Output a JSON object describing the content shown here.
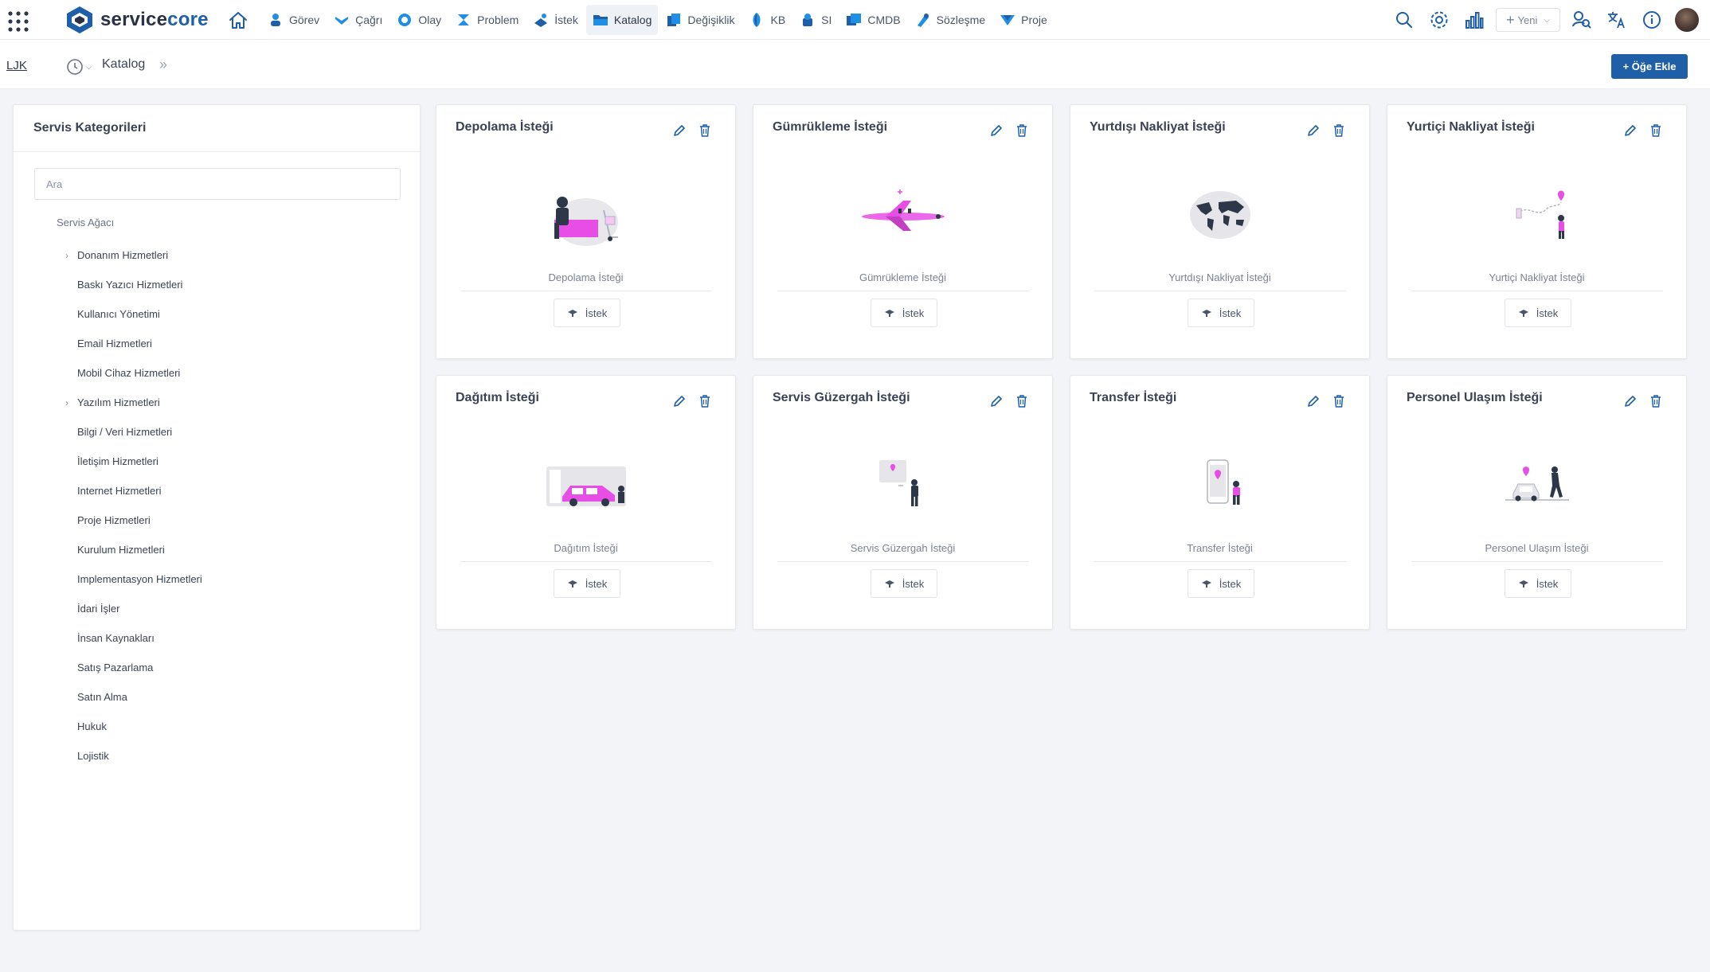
{
  "brand": {
    "name_part1": "service",
    "name_part2": "core",
    "accent_color": "#1f5fa8",
    "highlight_color": "#e64ee6"
  },
  "nav": {
    "items": [
      {
        "label": "Görev",
        "icon": "task-icon",
        "active": false
      },
      {
        "label": "Çağrı",
        "icon": "call-icon",
        "active": false
      },
      {
        "label": "Olay",
        "icon": "incident-icon",
        "active": false
      },
      {
        "label": "Problem",
        "icon": "problem-icon",
        "active": false
      },
      {
        "label": "İstek",
        "icon": "request-icon",
        "active": false
      },
      {
        "label": "Katalog",
        "icon": "catalog-icon",
        "active": true
      },
      {
        "label": "Değişiklik",
        "icon": "change-icon",
        "active": false
      },
      {
        "label": "KB",
        "icon": "kb-icon",
        "active": false
      },
      {
        "label": "SI",
        "icon": "si-icon",
        "active": false
      },
      {
        "label": "CMDB",
        "icon": "cmdb-icon",
        "active": false
      },
      {
        "label": "Sözleşme",
        "icon": "contract-icon",
        "active": false
      },
      {
        "label": "Proje",
        "icon": "project-icon",
        "active": false
      }
    ],
    "new_label": "Yeni"
  },
  "subheader": {
    "workspace": "LJK",
    "page_title": "Katalog",
    "add_item_label": "+ Öğe Ekle"
  },
  "sidebar": {
    "title": "Servis Kategorileri",
    "search_placeholder": "Ara",
    "tree_root": "Servis Ağacı",
    "items": [
      {
        "label": "Donanım Hizmetleri",
        "expandable": true
      },
      {
        "label": "Baskı Yazıcı Hizmetleri",
        "expandable": false
      },
      {
        "label": "Kullanıcı Yönetimi",
        "expandable": false
      },
      {
        "label": "Email Hizmetleri",
        "expandable": false
      },
      {
        "label": "Mobil Cihaz Hizmetleri",
        "expandable": false
      },
      {
        "label": "Yazılım Hizmetleri",
        "expandable": true
      },
      {
        "label": "Bilgi / Veri Hizmetleri",
        "expandable": false
      },
      {
        "label": "İletişim Hizmetleri",
        "expandable": false
      },
      {
        "label": "Internet Hizmetleri",
        "expandable": false
      },
      {
        "label": "Proje Hizmetleri",
        "expandable": false
      },
      {
        "label": "Kurulum Hizmetleri",
        "expandable": false
      },
      {
        "label": "Implementasyon Hizmetleri",
        "expandable": false
      },
      {
        "label": "İdari İşler",
        "expandable": false
      },
      {
        "label": "İnsan Kaynakları",
        "expandable": false
      },
      {
        "label": "Satış Pazarlama",
        "expandable": false
      },
      {
        "label": "Satın Alma",
        "expandable": false
      },
      {
        "label": "Hukuk",
        "expandable": false
      },
      {
        "label": "Lojistik",
        "expandable": false
      }
    ]
  },
  "cards": [
    {
      "title": "Depolama İsteği",
      "subtitle": "Depolama İsteği",
      "button": "İstek",
      "illustration": "storage-illustration"
    },
    {
      "title": "Gümrükleme İsteği",
      "subtitle": "Gümrükleme İsteği",
      "button": "İstek",
      "illustration": "airplane-illustration"
    },
    {
      "title": "Yurtdışı Nakliyat İsteği",
      "subtitle": "Yurtdışı Nakliyat İsteği",
      "button": "İstek",
      "illustration": "world-map-illustration"
    },
    {
      "title": "Yurtiçi Nakliyat İsteği",
      "subtitle": "Yurtiçi Nakliyat İsteği",
      "button": "İstek",
      "illustration": "route-illustration"
    },
    {
      "title": "Dağıtım İsteği",
      "subtitle": "Dağıtım İsteği",
      "button": "İstek",
      "illustration": "delivery-truck-illustration"
    },
    {
      "title": "Servis Güzergah İsteği",
      "subtitle": "Servis Güzergah İsteği",
      "button": "İstek",
      "illustration": "map-pin-person-illustration"
    },
    {
      "title": "Transfer İsteği",
      "subtitle": "Transfer İsteği",
      "button": "İstek",
      "illustration": "phone-location-illustration"
    },
    {
      "title": "Personel Ulaşım İsteği",
      "subtitle": "Personel Ulaşım İsteği",
      "button": "İstek",
      "illustration": "car-person-illustration"
    }
  ]
}
